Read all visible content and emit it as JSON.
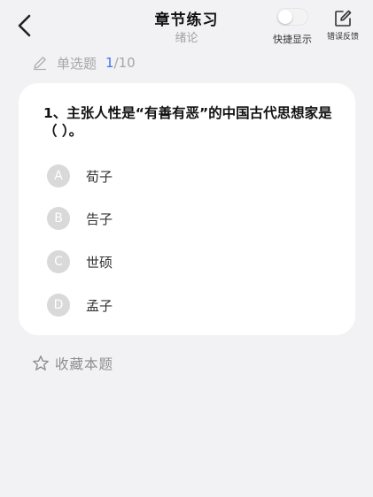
{
  "header": {
    "title": "章节练习",
    "subtitle": "绪论",
    "quick_display_label": "快捷显示",
    "quick_display_on": false,
    "feedback_label": "错误反馈"
  },
  "progress": {
    "question_type": "单选题",
    "current": "1",
    "total": "/10"
  },
  "question": {
    "text": "1、主张人性是“有善有恶”的中国古代思想家是（    ）。",
    "options": [
      {
        "letter": "A",
        "text": "荀子"
      },
      {
        "letter": "B",
        "text": "告子"
      },
      {
        "letter": "C",
        "text": "世硕"
      },
      {
        "letter": "D",
        "text": "孟子"
      }
    ]
  },
  "footer": {
    "collect_label": "收藏本题"
  },
  "icons": {
    "back": "chevron-left-icon",
    "feedback": "edit-icon",
    "question_type": "pencil-icon",
    "collect": "star-outline-icon"
  },
  "colors": {
    "background": "#f2f2f4",
    "card": "#ffffff",
    "accent": "#3c74f5",
    "option_badge": "#d9d9d9",
    "muted_text": "#a6a6a6"
  }
}
